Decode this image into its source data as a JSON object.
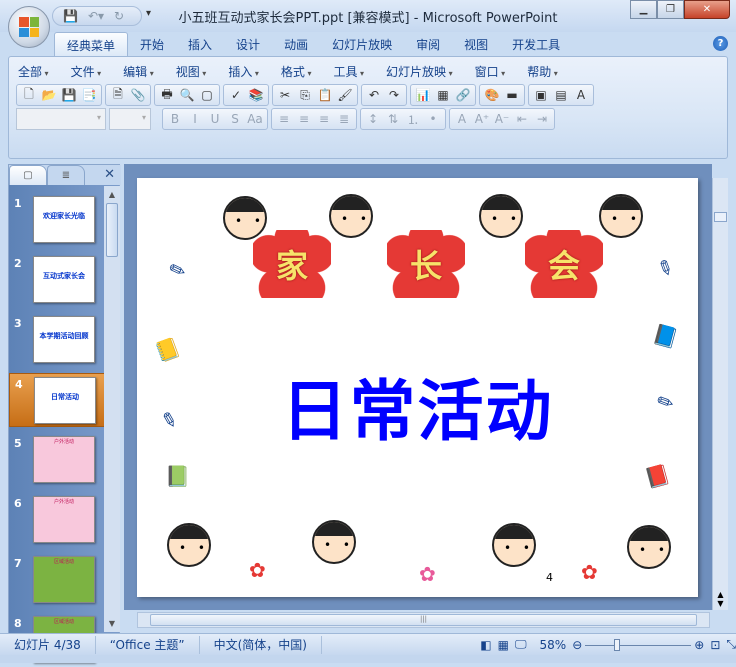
{
  "window": {
    "title": "小五班互动式家长会PPT.ppt [兼容模式] - Microsoft PowerPoint",
    "controls": [
      "minimize",
      "restore",
      "close"
    ]
  },
  "quick_access": [
    "save-icon",
    "undo-icon",
    "redo-icon"
  ],
  "tabs": [
    "经典菜单",
    "开始",
    "插入",
    "设计",
    "动画",
    "幻灯片放映",
    "审阅",
    "视图",
    "开发工具"
  ],
  "help": "?",
  "menu": [
    "全部",
    "文件",
    "编辑",
    "视图",
    "插入",
    "格式",
    "工具",
    "幻灯片放映",
    "窗口",
    "帮助"
  ],
  "toolbar1": [
    {
      "icons": [
        [
          "new",
          "🗋"
        ],
        [
          "open",
          "📂"
        ],
        [
          "save",
          "💾"
        ],
        [
          "permission",
          "📑"
        ]
      ]
    },
    {
      "icons": [
        [
          "delete",
          "🗎"
        ],
        [
          "attach",
          "📎"
        ]
      ]
    },
    {
      "icons": [
        [
          "print",
          "🖶"
        ],
        [
          "print-preview",
          "🔍"
        ],
        [
          "frame",
          "▢"
        ]
      ]
    },
    {
      "icons": [
        [
          "spelling",
          "✓"
        ],
        [
          "research",
          "📚"
        ]
      ]
    },
    {
      "icons": [
        [
          "cut",
          "✂"
        ],
        [
          "copy",
          "⎘"
        ],
        [
          "paste",
          "📋"
        ],
        [
          "format-painter",
          "🖌"
        ]
      ]
    },
    {
      "icons": [
        [
          "undo",
          "↶"
        ],
        [
          "redo",
          "↷"
        ]
      ]
    },
    {
      "icons": [
        [
          "chart",
          "📊"
        ],
        [
          "table",
          "▦"
        ],
        [
          "hyperlink",
          "🔗"
        ]
      ]
    },
    {
      "icons": [
        [
          "color-scheme",
          "🎨"
        ],
        [
          "fill",
          "▬"
        ]
      ]
    },
    {
      "icons": [
        [
          "new-slide",
          "▣"
        ],
        [
          "layout",
          "▤"
        ],
        [
          "text-box",
          "A"
        ]
      ]
    }
  ],
  "toolbar2": [
    {
      "icons": [
        [
          "bold",
          "B"
        ],
        [
          "italic",
          "I"
        ],
        [
          "underline",
          "U"
        ],
        [
          "shadow",
          "S"
        ],
        [
          "change-case",
          "Aa"
        ]
      ]
    },
    {
      "icons": [
        [
          "align-left",
          "≡"
        ],
        [
          "align-center",
          "≡"
        ],
        [
          "align-right",
          "≡"
        ],
        [
          "justify",
          "≣"
        ]
      ]
    },
    {
      "icons": [
        [
          "line-spacing",
          "↕"
        ],
        [
          "text-direction",
          "⇅"
        ],
        [
          "numbering",
          "⒈"
        ],
        [
          "bullets",
          "•"
        ]
      ]
    },
    {
      "icons": [
        [
          "font-color",
          "A"
        ],
        [
          "grow-font",
          "A⁺"
        ],
        [
          "shrink-font",
          "A⁻"
        ],
        [
          "decrease-indent",
          "⇤"
        ],
        [
          "increase-indent",
          "⇥"
        ]
      ]
    }
  ],
  "slides_pane": {
    "tabs": [
      "slides-tab",
      "outline-tab"
    ],
    "close": "✕",
    "thumbnails": [
      {
        "num": "1",
        "text": "欢迎家长光临"
      },
      {
        "num": "2",
        "text": "互动式家长会"
      },
      {
        "num": "3",
        "text": "本学期活动回顾"
      },
      {
        "num": "4",
        "text": "日常活动"
      },
      {
        "num": "5",
        "text": "户外活动"
      },
      {
        "num": "6",
        "text": "户外活动"
      },
      {
        "num": "7",
        "text": "区域活动"
      },
      {
        "num": "8",
        "text": "区域活动"
      }
    ],
    "selected": 4
  },
  "slide": {
    "flowers": [
      "家",
      "长",
      "会"
    ],
    "title": "日常活动",
    "page_number": "4"
  },
  "status": {
    "slide": "幻灯片 4/38",
    "theme": "“Office 主题”",
    "language": "中文(简体，中国)",
    "zoom": "58%",
    "zoom_fraction": 0.58
  },
  "colors": {
    "title_blue": "#0000ff",
    "flower_red": "#e53935",
    "selected_orange": "#e9a04f"
  }
}
